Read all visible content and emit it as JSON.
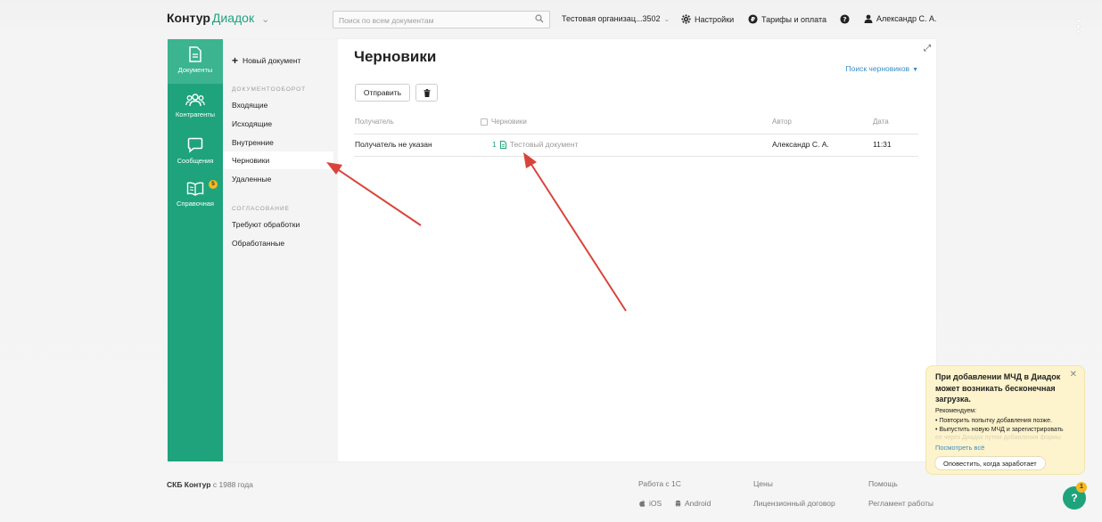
{
  "header": {
    "logo_part1": "Контур",
    "logo_part2": "Диадок",
    "search_placeholder": "Поиск по всем документам",
    "organization": "Тестовая организац...3502",
    "settings_label": "Настройки",
    "tariffs_label": "Тарифы и оплата",
    "user_name": "Александр С. А."
  },
  "rail": {
    "items": [
      {
        "label": "Документы",
        "icon": "document-icon"
      },
      {
        "label": "Контрагенты",
        "icon": "contacts-icon"
      },
      {
        "label": "Сообщения",
        "icon": "chat-icon"
      },
      {
        "label": "Справочная",
        "icon": "book-icon",
        "badge": "5"
      }
    ]
  },
  "menu": {
    "new_document": "Новый документ",
    "section_docflow": "ДОКУМЕНТООБОРОТ",
    "docflow_items": [
      "Входящие",
      "Исходящие",
      "Внутренние",
      "Черновики",
      "Удаленные"
    ],
    "section_approval": "СОГЛАСОВАНИЕ",
    "approval_items": [
      "Требуют обработки",
      "Обработанные"
    ]
  },
  "main": {
    "title": "Черновики",
    "search_drafts": "Поиск черновиков",
    "send_button": "Отправить",
    "columns": {
      "recipient": "Получатель",
      "drafts": "Черновики",
      "author": "Автор",
      "date": "Дата"
    },
    "rows": [
      {
        "recipient": "Получатель не указан",
        "count": "1",
        "document": "Тестовый документ",
        "author": "Александр С. А.",
        "date": "11:31"
      }
    ]
  },
  "footer": {
    "company": "СКБ Контур",
    "since": "с 1988 года",
    "links": [
      "Работа с 1С",
      "Цены",
      "Помощь",
      "iOS",
      "Android",
      "Лицензионный договор",
      "Регламент работы"
    ]
  },
  "notification": {
    "title": "При добавлении МЧД в Диадок может возникать бесконечная загрузка.",
    "recommend": "Рекомендуем:",
    "bullet1": "• Повторить попытку добавления позже.",
    "bullet2": "• Выпустить новую МЧД и зарегистрировать",
    "faded": "ее через Диадок путем добавления формы",
    "link": "Посмотреть всё",
    "button": "Оповестить, когда заработает"
  },
  "help": {
    "label": "?",
    "badge": "1"
  },
  "colors": {
    "brand_green": "#1fa37c",
    "active_rail": "#3bb48f",
    "link_blue": "#3a8fc4",
    "badge_yellow": "#f5b91f",
    "arrow_red": "#d9443a"
  }
}
